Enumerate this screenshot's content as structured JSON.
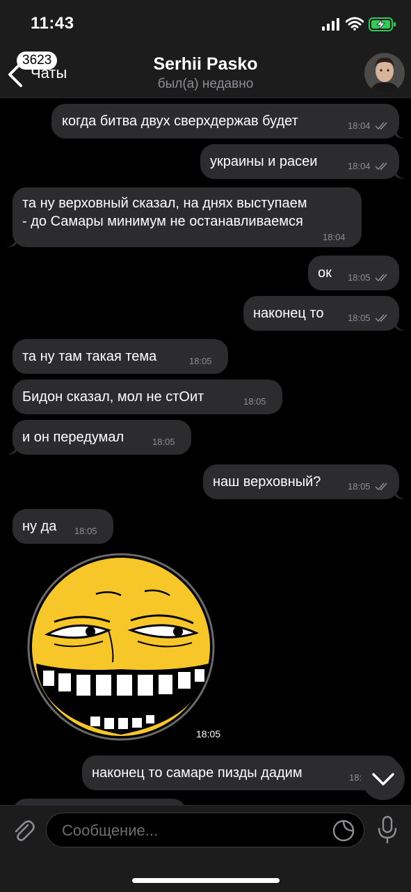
{
  "status_bar": {
    "time": "11:43"
  },
  "header": {
    "back_label": "Чаты",
    "unread_count": "3623",
    "title": "Serhii Pasko",
    "subtitle": "был(а) недавно"
  },
  "messages": [
    {
      "text": "когда битва двух сверхдержав будет",
      "time": "18:04",
      "outgoing": true
    },
    {
      "text": "украины и расеи",
      "time": "18:04",
      "outgoing": true
    },
    {
      "text": "та ну верховный сказал, на днях выступаем",
      "text2": "- до Самары минимум не останавливаемся",
      "time": "18:04",
      "outgoing": false
    },
    {
      "text": "ок",
      "time": "18:05",
      "outgoing": true
    },
    {
      "text": "наконец то",
      "time": "18:05",
      "outgoing": true
    },
    {
      "text": "та ну там такая тема",
      "time": "18:05",
      "outgoing": false
    },
    {
      "text": "Бидон сказал, мол не стОит",
      "time": "18:05",
      "outgoing": false
    },
    {
      "text": "и он передумал",
      "time": "18:05",
      "outgoing": false
    },
    {
      "text": "наш верховный?",
      "time": "18:05",
      "outgoing": true
    },
    {
      "text": "ну да",
      "time": "18:05",
      "outgoing": false
    },
    {
      "text": "наконец то самаре пизды дадим",
      "time": "18:",
      "outgoing": true
    }
  ],
  "sticker": {
    "name": "grinning-troll-face-sticker",
    "time": "18:05"
  },
  "input": {
    "placeholder": "Сообщение..."
  },
  "colors": {
    "bubble": "#2c2c2e",
    "bar": "#1c1c1d",
    "battery": "#34c759"
  }
}
